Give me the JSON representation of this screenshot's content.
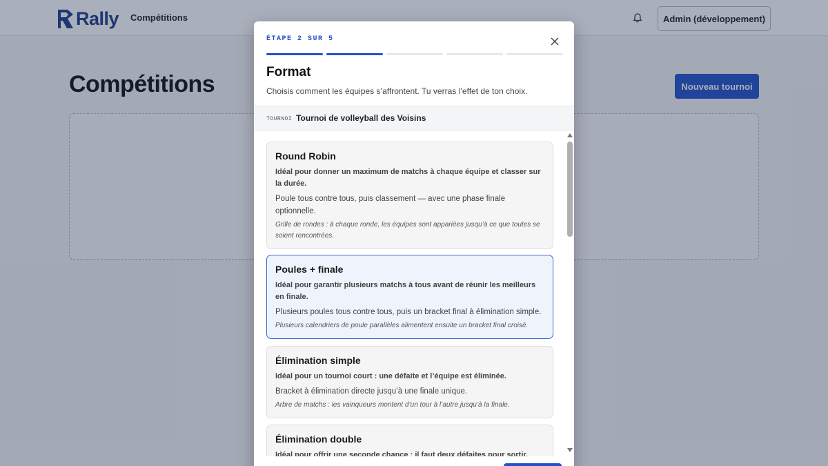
{
  "app": {
    "logo_text": "Rally",
    "nav_link": "Compétitions",
    "admin_label": "Admin (développement)",
    "brand_color": "#1f3d8a",
    "accent_color": "#2451c9"
  },
  "page": {
    "title": "Compétitions",
    "new_button": "Nouveau tournoi"
  },
  "modal": {
    "step_label": "ÉTAPE 2 SUR 5",
    "progress": {
      "current_step": 2,
      "total_steps": 5
    },
    "title": "Format",
    "description": "Choisis comment les équipes s’affrontent. Tu verras l’effet de ton choix.",
    "tournament_tag": "TOURNOI",
    "tournament_name": "Tournoi de volleyball des Voisins",
    "formats": [
      {
        "title": "Round Robin",
        "ideal": "Idéal pour donner un maximum de matchs à chaque équipe et classer sur la durée.",
        "description": "Poule tous contre tous, puis classement — avec une phase finale optionnelle.",
        "note": "Grille de rondes : à chaque ronde, les équipes sont appariées jusqu’à ce que toutes se soient rencontrées.",
        "selected": false
      },
      {
        "title": "Poules + finale",
        "ideal": "Idéal pour garantir plusieurs matchs à tous avant de réunir les meilleurs en finale.",
        "description": "Plusieurs poules tous contre tous, puis un bracket final à élimination simple.",
        "note": "Plusieurs calendriers de poule parallèles alimentent ensuite un bracket final croisé.",
        "selected": true
      },
      {
        "title": "Élimination simple",
        "ideal": "Idéal pour un tournoi court : une défaite et l’équipe est éliminée.",
        "description": "Bracket à élimination directe jusqu’à une finale unique.",
        "note": "Arbre de matchs : les vainqueurs montent d’un tour à l’autre jusqu’à la finale.",
        "selected": false
      },
      {
        "title": "Élimination double",
        "ideal": "Idéal pour offrir une seconde chance : il faut deux défaites pour sortir.",
        "description": "",
        "note": "",
        "selected": false
      }
    ]
  }
}
